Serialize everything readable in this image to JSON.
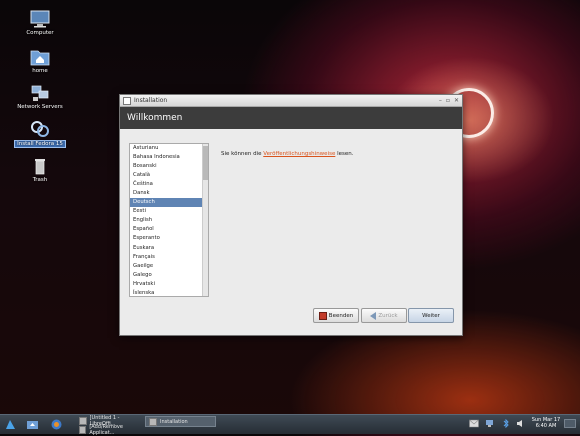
{
  "desktop": {
    "icons": [
      {
        "label": "Computer"
      },
      {
        "label": "home"
      },
      {
        "label": "Network Servers"
      },
      {
        "label": "Install Fedora 15"
      },
      {
        "label": "Trash"
      }
    ]
  },
  "window": {
    "title": "Installation",
    "banner": "Willkommen",
    "languages": [
      "Asturianu",
      "Bahasa Indonesia",
      "Bosanski",
      "Català",
      "Čeština",
      "Dansk",
      "Deutsch",
      "Eesti",
      "English",
      "Español",
      "Esperanto",
      "Euskara",
      "Français",
      "Gaeilge",
      "Galego",
      "Hrvatski",
      "Íslenska"
    ],
    "selected_language": "Deutsch",
    "notes_prefix": "Sie können die ",
    "notes_link": "Veröffentlichungshinweise",
    "notes_suffix": " lesen.",
    "buttons": {
      "quit": "Beenden",
      "back": "Zurück",
      "forward": "Weiter"
    }
  },
  "taskbar": {
    "tasks": [
      {
        "label": "[Untitled 1 - LibreOffi..."
      },
      {
        "label": "[Add/Remove Applicat..."
      },
      {
        "label": "Installation"
      }
    ],
    "clock_day": "Sun Mar 17",
    "clock_time": "6:40 AM"
  }
}
